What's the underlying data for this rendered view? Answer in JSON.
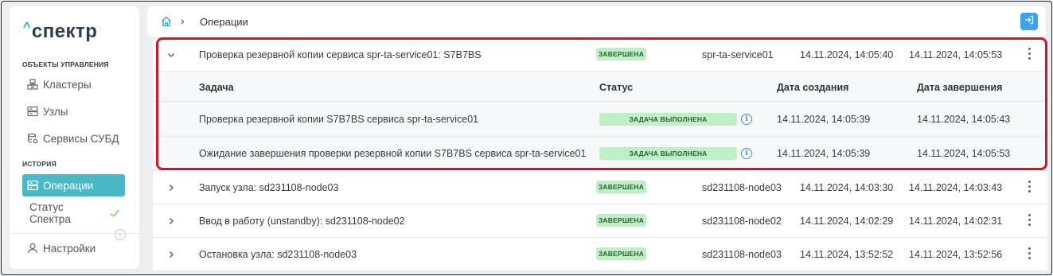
{
  "app": {
    "logo_caret": "^",
    "logo_text": "спектр"
  },
  "sidebar": {
    "section_objects": "ОБЪЕКТЫ УПРАВЛЕНИЯ",
    "section_history": "ИСТОРИЯ",
    "items": [
      {
        "label": "Кластеры",
        "icon": "cluster-icon"
      },
      {
        "label": "Узлы",
        "icon": "server-icon"
      },
      {
        "label": "Сервисы СУБД",
        "icon": "database-icon"
      },
      {
        "label": "Операции",
        "icon": "operations-icon",
        "active": true
      },
      {
        "label": "Статус Спектра",
        "icon": "check-icon"
      },
      {
        "label": "Настройки",
        "icon": "user-icon"
      }
    ]
  },
  "header": {
    "breadcrumb_label": "Операции"
  },
  "operations": [
    {
      "name": "Проверка резервной копии сервиса spr-ta-service01: S7B7BS",
      "status": "ЗАВЕРШЕНА",
      "target": "spr-ta-service01",
      "created": "14.11.2024, 14:05:40",
      "finished": "14.11.2024, 14:05:53",
      "expanded": true
    },
    {
      "name": "Запуск узла: sd231108-node03",
      "status": "ЗАВЕРШЕНА",
      "target": "sd231108-node03",
      "created": "14.11.2024, 14:03:30",
      "finished": "14.11.2024, 14:03:43"
    },
    {
      "name": "Ввод в работу (unstandby): sd231108-node02",
      "status": "ЗАВЕРШЕНА",
      "target": "sd231108-node02",
      "created": "14.11.2024, 14:02:29",
      "finished": "14.11.2024, 14:02:31"
    },
    {
      "name": "Остановка узла: sd231108-node03",
      "status": "ЗАВЕРШЕНА",
      "target": "sd231108-node03",
      "created": "14.11.2024, 13:52:52",
      "finished": "14.11.2024, 13:52:56"
    }
  ],
  "subtable": {
    "headers": {
      "task": "Задача",
      "status": "Статус",
      "created": "Дата создания",
      "finished": "Дата завершения"
    },
    "rows": [
      {
        "task": "Проверка резервной копии S7B7BS сервиса spr-ta-service01",
        "status": "ЗАДАЧА ВЫПОЛНЕНА",
        "created": "14.11.2024, 14:05:39",
        "finished": "14.11.2024, 14:05:43"
      },
      {
        "task": "Ожидание завершения проверки резервной копии S7B7BS сервиса spr-ta-service01",
        "status": "ЗАДАЧА ВЫПОЛНЕНА",
        "created": "14.11.2024, 14:05:39",
        "finished": "14.11.2024, 14:05:53"
      }
    ]
  },
  "colors": {
    "accent": "#4bb8c5",
    "badge_bg": "#bff0c5",
    "highlight": "#c81a2a",
    "primary_button": "#3fa1ec"
  }
}
